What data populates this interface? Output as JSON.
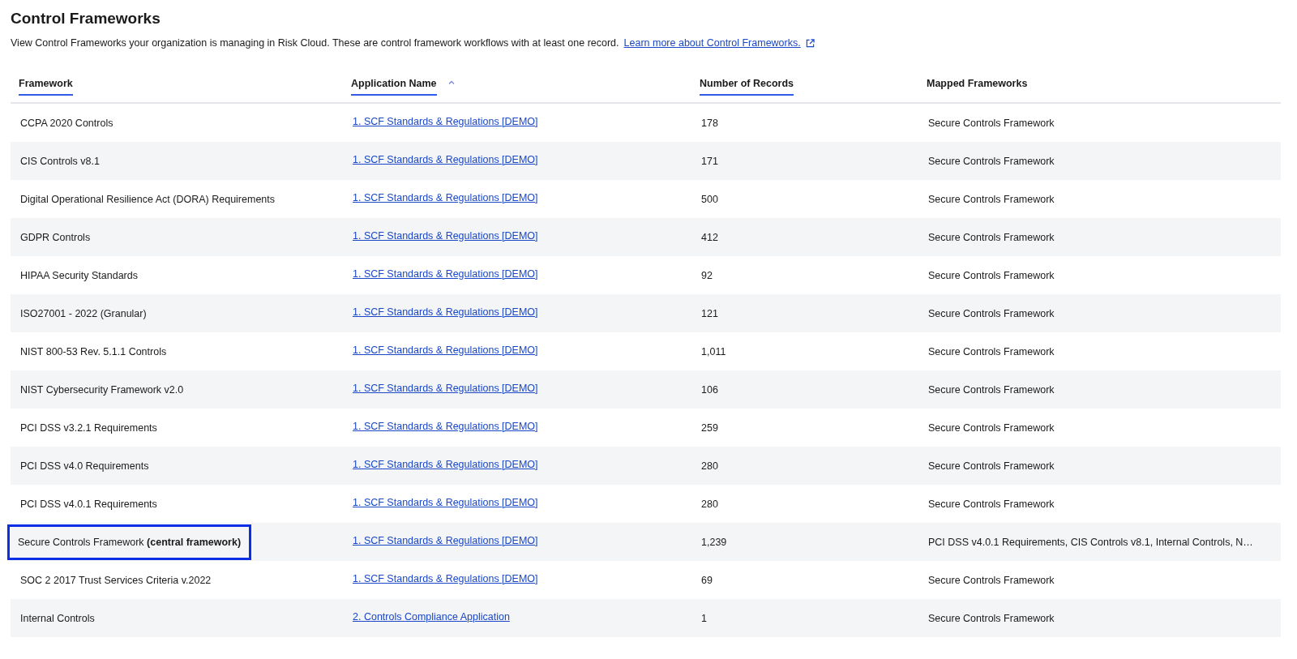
{
  "page": {
    "title": "Control Frameworks",
    "description": "View Control Frameworks your organization is managing in Risk Cloud. These are control framework workflows with at least one record.",
    "learn_more_link": "Learn more about Control Frameworks."
  },
  "table": {
    "columns": [
      {
        "label": "Framework",
        "underlined": true,
        "sorted": false
      },
      {
        "label": "Application Name",
        "underlined": true,
        "sorted": true
      },
      {
        "label": "Number of Records",
        "underlined": true,
        "sorted": false
      },
      {
        "label": "Mapped Frameworks",
        "underlined": false,
        "sorted": false
      }
    ],
    "rows": [
      {
        "framework": "CCPA 2020 Controls",
        "application": "1. SCF Standards & Regulations [DEMO]",
        "records": "178",
        "mapped": "Secure Controls Framework",
        "highlighted": false
      },
      {
        "framework": "CIS Controls v8.1",
        "application": "1. SCF Standards & Regulations [DEMO]",
        "records": "171",
        "mapped": "Secure Controls Framework",
        "highlighted": false
      },
      {
        "framework": "Digital Operational Resilience Act (DORA) Requirements",
        "application": "1. SCF Standards & Regulations [DEMO]",
        "records": "500",
        "mapped": "Secure Controls Framework",
        "highlighted": false
      },
      {
        "framework": "GDPR Controls",
        "application": "1. SCF Standards & Regulations [DEMO]",
        "records": "412",
        "mapped": "Secure Controls Framework",
        "highlighted": false
      },
      {
        "framework": "HIPAA Security Standards",
        "application": "1. SCF Standards & Regulations [DEMO]",
        "records": "92",
        "mapped": "Secure Controls Framework",
        "highlighted": false
      },
      {
        "framework": "ISO27001 - 2022 (Granular)",
        "application": "1. SCF Standards & Regulations [DEMO]",
        "records": "121",
        "mapped": "Secure Controls Framework",
        "highlighted": false
      },
      {
        "framework": "NIST 800-53 Rev. 5.1.1 Controls",
        "application": "1. SCF Standards & Regulations [DEMO]",
        "records": "1,011",
        "mapped": "Secure Controls Framework",
        "highlighted": false
      },
      {
        "framework": "NIST Cybersecurity Framework v2.0",
        "application": "1. SCF Standards & Regulations [DEMO]",
        "records": "106",
        "mapped": "Secure Controls Framework",
        "highlighted": false
      },
      {
        "framework": "PCI DSS v3.2.1 Requirements",
        "application": "1. SCF Standards & Regulations [DEMO]",
        "records": "259",
        "mapped": "Secure Controls Framework",
        "highlighted": false
      },
      {
        "framework": "PCI DSS v4.0 Requirements",
        "application": "1. SCF Standards & Regulations [DEMO]",
        "records": "280",
        "mapped": "Secure Controls Framework",
        "highlighted": false
      },
      {
        "framework": "PCI DSS v4.0.1 Requirements",
        "application": "1. SCF Standards & Regulations [DEMO]",
        "records": "280",
        "mapped": "Secure Controls Framework",
        "highlighted": false
      },
      {
        "framework": "Secure Controls Framework **(central framework)**",
        "application": "1. SCF Standards & Regulations [DEMO]",
        "records": "1,239",
        "mapped": "PCI DSS v4.0.1 Requirements, CIS Controls v8.1, Internal Controls, N…",
        "highlighted": true
      },
      {
        "framework": "SOC 2 2017 Trust Services Criteria v.2022",
        "application": "1. SCF Standards & Regulations [DEMO]",
        "records": "69",
        "mapped": "Secure Controls Framework",
        "highlighted": false
      },
      {
        "framework": "Internal Controls",
        "application": "2. Controls Compliance Application",
        "records": "1",
        "mapped": "Secure Controls Framework",
        "highlighted": false
      }
    ]
  }
}
